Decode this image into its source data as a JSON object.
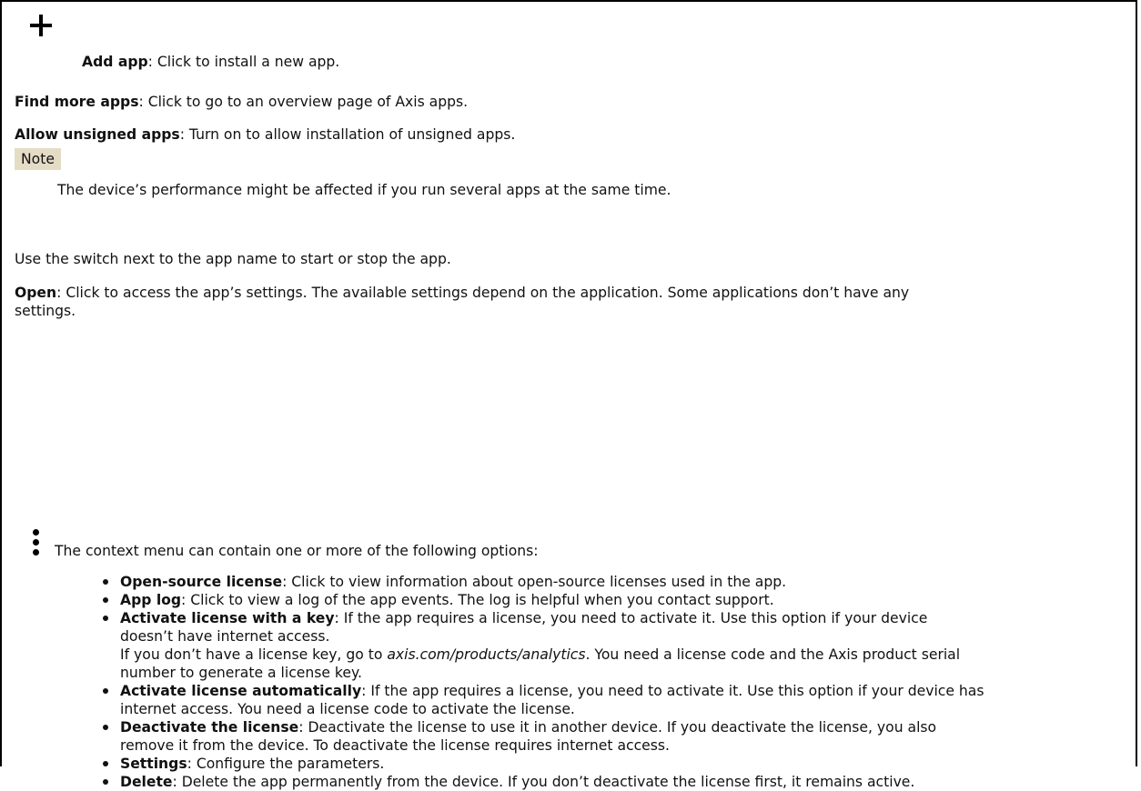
{
  "add_app": {
    "label": "Add app",
    "text": ": Click to install a new app."
  },
  "find_more": {
    "label": "Find more apps",
    "text": ": Click to go to an overview page of Axis apps."
  },
  "allow_unsigned": {
    "label": "Allow unsigned apps",
    "text": ": Turn on to allow installation of unsigned apps."
  },
  "note": {
    "tag": "Note",
    "text": "The device’s performance might be affected if you run several apps at the same time."
  },
  "switch_text": "Use the switch next to the app name to start or stop the app.",
  "open": {
    "label": "Open",
    "line1": ": Click to access the app’s settings. The available settings depend on the application. Some applications don’t have any",
    "line2": "settings."
  },
  "context_menu": {
    "icon": "more-vertical-icon",
    "text": "The context menu can contain one or more of the following options:",
    "options": [
      {
        "label": "Open-source license",
        "lines": [
          ": Click to view information about open-source licenses used in the app."
        ]
      },
      {
        "label": "App log",
        "lines": [
          ": Click to view a log of the app events. The log is helpful when you contact support."
        ]
      },
      {
        "label": "Activate license with a key",
        "lines": [
          ": If the app requires a license, you need to activate it. Use this option if your device",
          "doesn’t have internet access."
        ],
        "extra_pre": "If you don’t have a license key, go to ",
        "extra_link": "axis.com/products/analytics",
        "extra_post": ". You need a license code and the Axis product serial",
        "extra_line2": "number to generate a license key."
      },
      {
        "label": "Activate license automatically",
        "lines": [
          ": If the app requires a license, you need to activate it. Use this option if your device has",
          "internet access. You need a license code to activate the license."
        ]
      },
      {
        "label": "Deactivate the license",
        "lines": [
          ": Deactivate the license to use it in another device. If you deactivate the license, you also",
          "remove it from the device. To deactivate the license requires internet access."
        ]
      },
      {
        "label": "Settings",
        "lines": [
          ": Configure the parameters."
        ]
      },
      {
        "label": "Delete",
        "lines": [
          ": Delete the app permanently from the device. If you don’t deactivate the license first, it remains active."
        ]
      }
    ]
  }
}
